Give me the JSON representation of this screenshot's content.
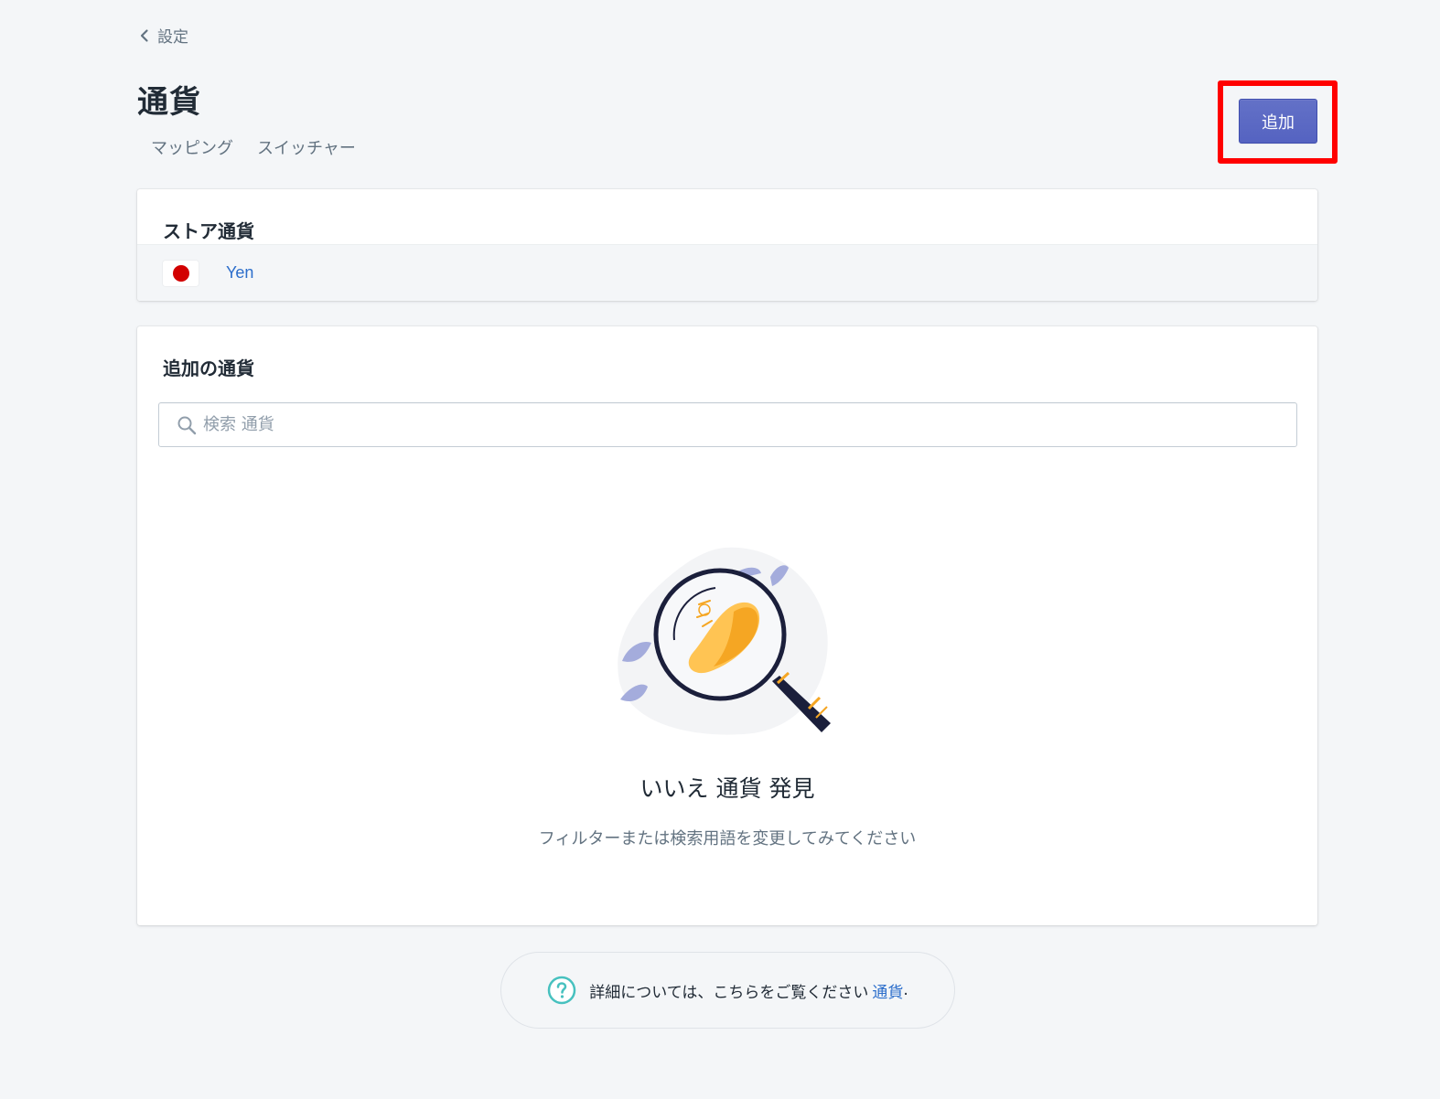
{
  "breadcrumb": {
    "label": "設定"
  },
  "page": {
    "title": "通貨"
  },
  "secondary_actions": [
    {
      "label": "マッピング"
    },
    {
      "label": "スイッチャー"
    }
  ],
  "primary_action": {
    "label": "追加"
  },
  "store_currency": {
    "heading": "ストア通貨",
    "currency_name": "Yen",
    "flag": "japan-flag-icon"
  },
  "additional_currencies": {
    "heading": "追加の通貨",
    "search": {
      "placeholder": "検索 通貨",
      "value": ""
    },
    "empty_state": {
      "heading": "いいえ 通貨 発見",
      "subtext": "フィルターまたは検索用語を変更してみてください"
    }
  },
  "footer_help": {
    "text": "詳細については、こちらをご覧ください",
    "link_label": "通貨",
    "suffix": "."
  },
  "colors": {
    "primary": "#5c6ac4",
    "link": "#2c6ecb",
    "highlight": "#ff0000",
    "help_icon": "#47c1bf",
    "flag_red": "#d20000"
  }
}
